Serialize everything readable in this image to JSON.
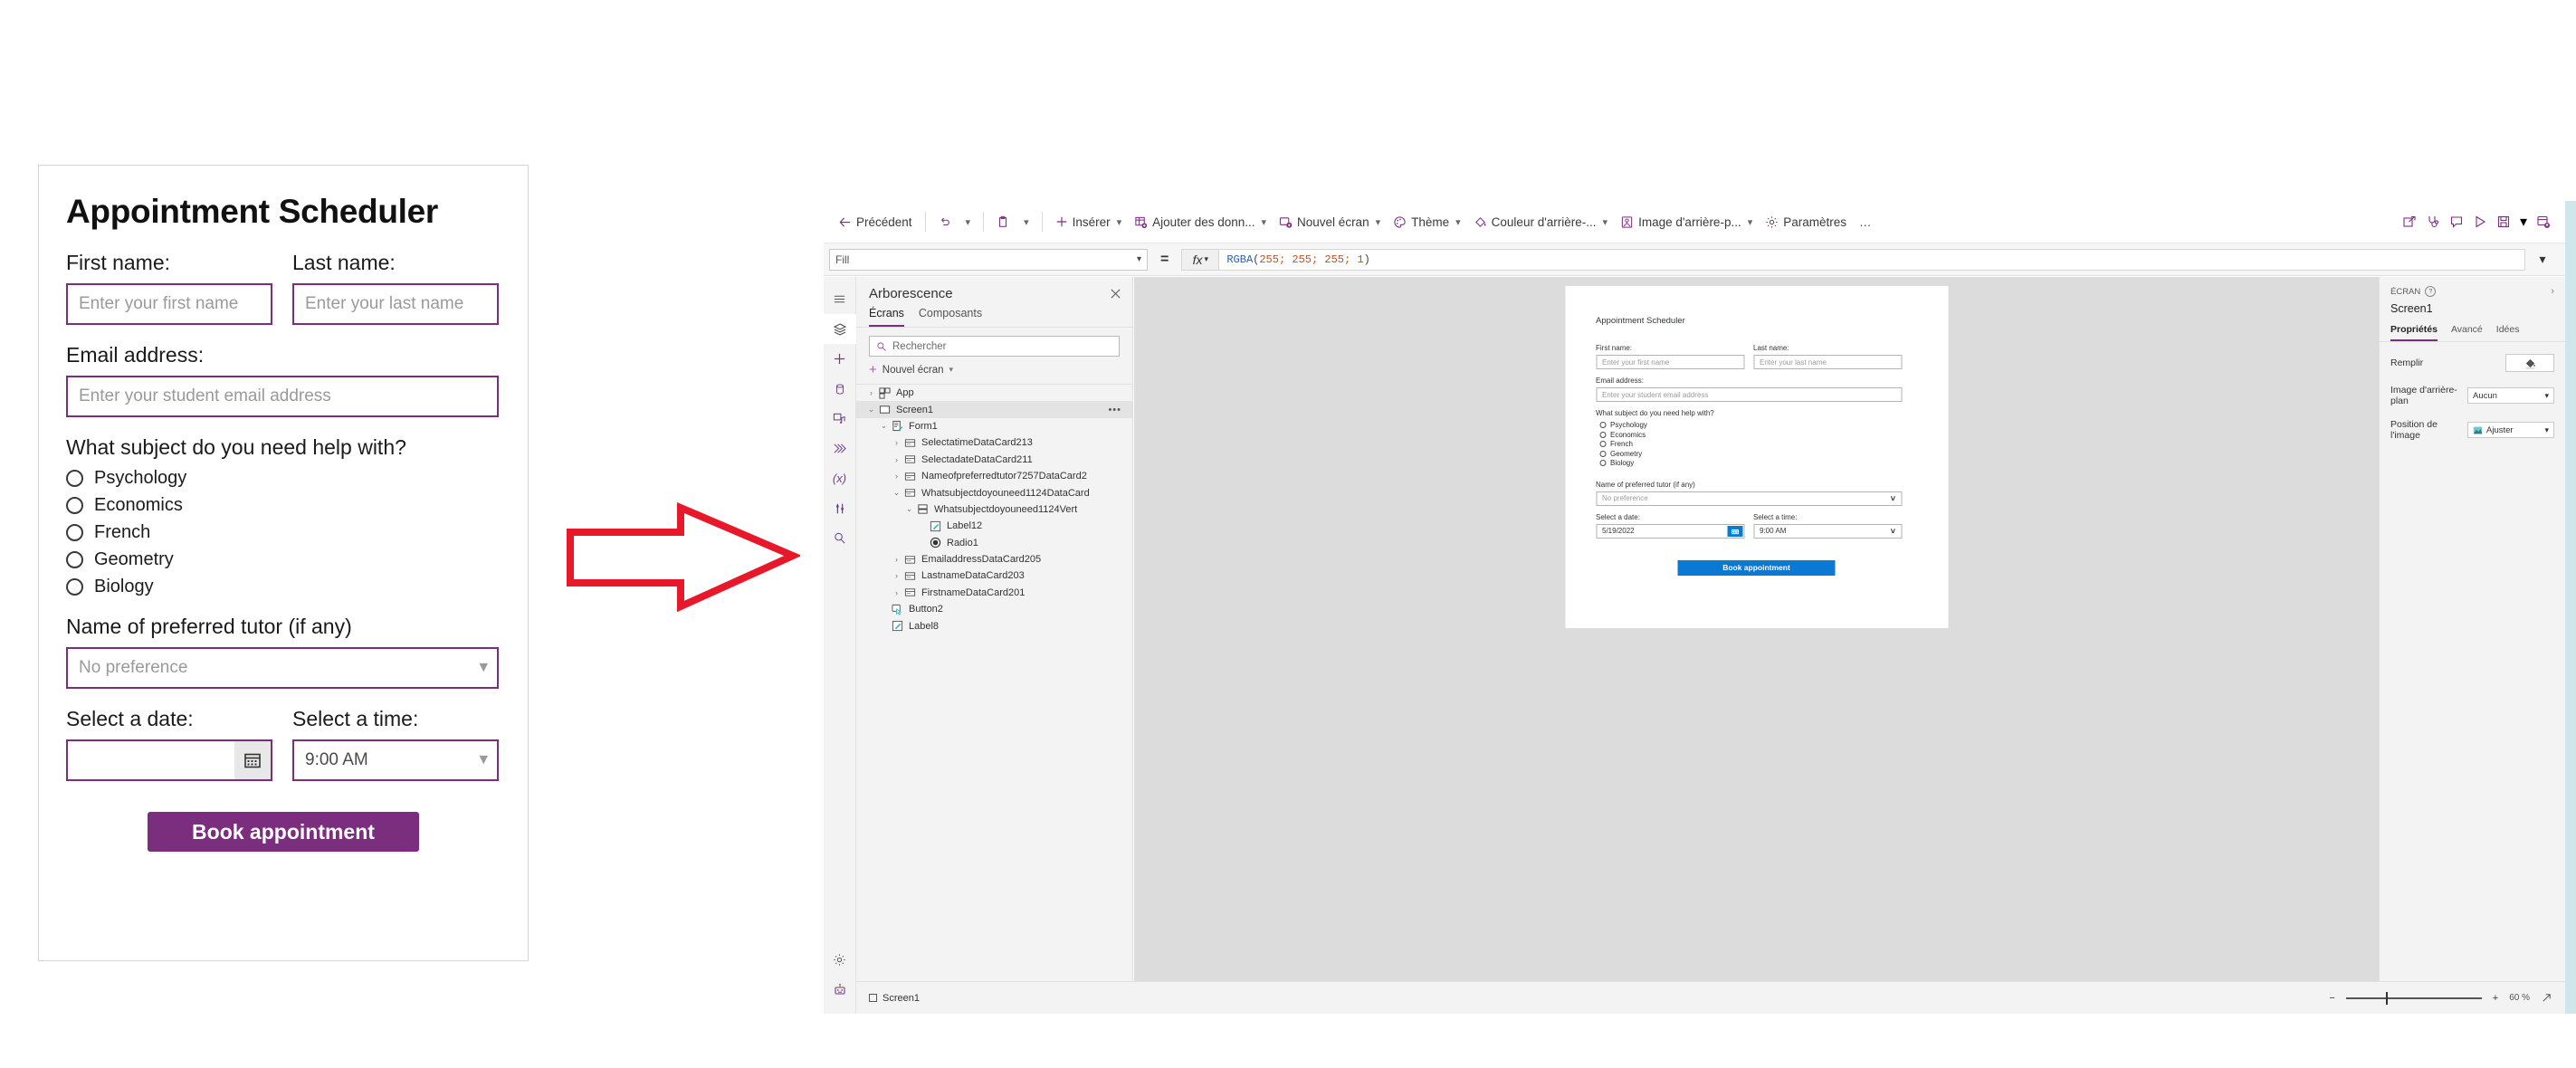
{
  "mockup": {
    "title": "Appointment Scheduler",
    "first_name_label": "First name:",
    "first_name_placeholder": "Enter your first name",
    "last_name_label": "Last name:",
    "last_name_placeholder": "Enter your last name",
    "email_label": "Email address:",
    "email_placeholder": "Enter your student email address",
    "subject_question": "What subject do you need help with?",
    "subjects": [
      "Psychology",
      "Economics",
      "French",
      "Geometry",
      "Biology"
    ],
    "tutor_label": "Name of preferred tutor (if any)",
    "tutor_value": "No preference",
    "date_label": "Select a date:",
    "date_value": "",
    "time_label": "Select a time:",
    "time_value": "9:00 AM",
    "book_button": "Book appointment",
    "accent_color": "#7B2D7E"
  },
  "powerapps": {
    "toolbar": {
      "back": "Précédent",
      "insert": "Insérer",
      "add_data": "Ajouter des donn...",
      "new_screen": "Nouvel écran",
      "theme": "Thème",
      "background_color": "Couleur d'arrière-...",
      "background_image": "Image d'arrière-p...",
      "settings": "Paramètres",
      "overflow": "…"
    },
    "formula_bar": {
      "property": "Fill",
      "equals": "=",
      "fx": "fx",
      "formula_fn": "RGBA",
      "formula_args": "255; 255; 255; 1"
    },
    "tree": {
      "title": "Arborescence",
      "tabs": [
        "Écrans",
        "Composants"
      ],
      "active_tab": "Écrans",
      "search_placeholder": "Rechercher",
      "new_screen": "Nouvel écran",
      "nodes": [
        {
          "label": "App",
          "depth": 0,
          "twisty": "right",
          "icon": "app-icon",
          "selected": false
        },
        {
          "label": "Screen1",
          "depth": 0,
          "twisty": "down",
          "icon": "screen-icon",
          "selected": true,
          "dots": "•••"
        },
        {
          "label": "Form1",
          "depth": 1,
          "twisty": "down",
          "icon": "form-icon",
          "selected": false
        },
        {
          "label": "SelectatimeDataCard213",
          "depth": 2,
          "twisty": "right",
          "icon": "card-icon",
          "selected": false
        },
        {
          "label": "SelectadateDataCard211",
          "depth": 2,
          "twisty": "right",
          "icon": "card-icon",
          "selected": false
        },
        {
          "label": "Nameofpreferredtutor7257DataCard2",
          "depth": 2,
          "twisty": "right",
          "icon": "card-icon",
          "selected": false
        },
        {
          "label": "Whatsubjectdoyouneed1124DataCard",
          "depth": 2,
          "twisty": "down",
          "icon": "card-icon",
          "selected": false
        },
        {
          "label": "Whatsubjectdoyouneed1124Vert",
          "depth": 3,
          "twisty": "down",
          "icon": "container-icon",
          "selected": false
        },
        {
          "label": "Label12",
          "depth": 4,
          "twisty": "none",
          "icon": "label-icon",
          "selected": false
        },
        {
          "label": "Radio1",
          "depth": 4,
          "twisty": "none",
          "icon": "radio-icon",
          "selected": false
        },
        {
          "label": "EmailaddressDataCard205",
          "depth": 2,
          "twisty": "right",
          "icon": "card-icon",
          "selected": false
        },
        {
          "label": "LastnameDataCard203",
          "depth": 2,
          "twisty": "right",
          "icon": "card-icon",
          "selected": false
        },
        {
          "label": "FirstnameDataCard201",
          "depth": 2,
          "twisty": "right",
          "icon": "card-icon",
          "selected": false
        },
        {
          "label": "Button2",
          "depth": 1,
          "twisty": "none",
          "icon": "button-icon",
          "selected": false
        },
        {
          "label": "Label8",
          "depth": 1,
          "twisty": "none",
          "icon": "label-icon",
          "selected": false
        }
      ]
    },
    "canvas_app": {
      "title": "Appointment Scheduler",
      "first_name_label": "First name:",
      "first_name_placeholder": "Enter your first name",
      "last_name_label": "Last name:",
      "last_name_placeholder": "Enter your last name",
      "email_label": "Email address:",
      "email_placeholder": "Enter your student email address",
      "subject_question": "What subject do you need help with?",
      "subjects": [
        "Psychology",
        "Economics",
        "French",
        "Geometry",
        "Biology"
      ],
      "tutor_label": "Name of preferred tutor (if any)",
      "tutor_value": "No preference",
      "date_label": "Select a date:",
      "date_value": "5/19/2022",
      "time_label": "Select a time:",
      "time_value": "9:00 AM",
      "book_button": "Book appointment",
      "button_color": "#0a78d4"
    },
    "properties": {
      "kicker": "ÉCRAN",
      "name": "Screen1",
      "tabs": [
        "Propriétés",
        "Avancé",
        "Idées"
      ],
      "active_tab": "Propriétés",
      "rows": [
        {
          "label": "Remplir",
          "value": ""
        },
        {
          "label": "Image d'arrière-plan",
          "value": "Aucun"
        },
        {
          "label": "Position de l'image",
          "value": "Ajuster"
        }
      ]
    },
    "status_bar": {
      "screen": "Screen1",
      "zoom_minus": "−",
      "zoom_plus": "+",
      "zoom_value": "60 %"
    }
  }
}
